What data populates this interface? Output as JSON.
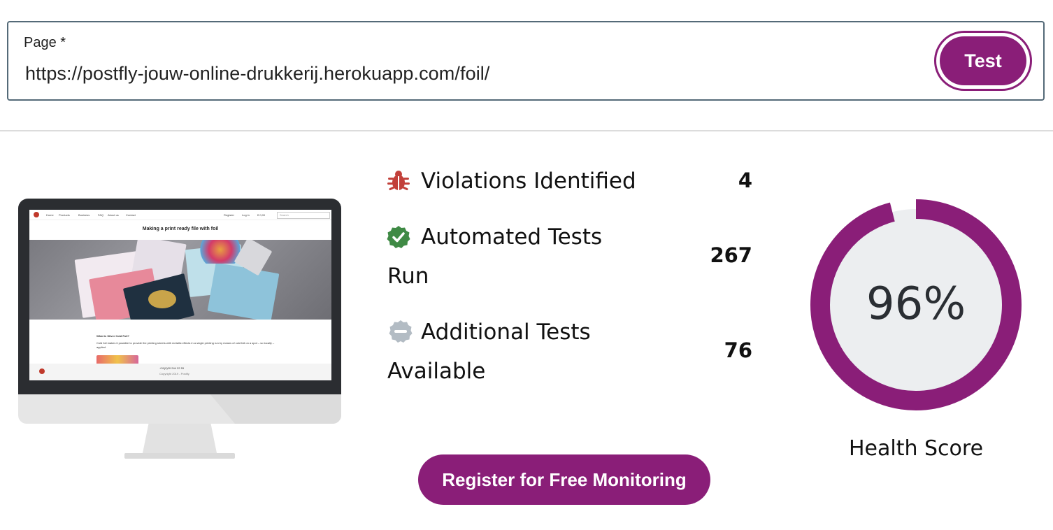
{
  "form": {
    "label": "Page *",
    "url": "https://postfly-jouw-online-drukkerij.herokuapp.com/foil/",
    "test_button": "Test"
  },
  "preview": {
    "page_title": "Making a print ready file with foil",
    "nav_items": [
      "Home",
      "Products",
      "Business",
      "FAQ",
      "About us",
      "Contact"
    ],
    "right_nav": [
      "Register",
      "Log in",
      "€ 0,00"
    ],
    "search_placeholder": "Search",
    "section_heading": "What is Silver Cold Foil?",
    "section_text": "Cold foil makes it possible to provide the printing sheets with metallic effects in a single printing run by means of cold foil on a spot – so locally – applied.",
    "footer_phone": "+31(0)20 244 22 53",
    "footer_copy": "Copyright 2019 - Postfly"
  },
  "stats": [
    {
      "icon": "bug-icon",
      "label": "Violations Identified",
      "value": "4"
    },
    {
      "icon": "check-badge-icon",
      "label": "Automated Tests Run",
      "value": "267"
    },
    {
      "icon": "minus-badge-icon",
      "label": "Additional Tests Available",
      "value": "76"
    }
  ],
  "register_button": "Register for Free Monitoring",
  "health": {
    "value_text": "96%",
    "fraction": 0.96,
    "label": "Health Score"
  },
  "colors": {
    "brand": "#8a1e78",
    "bug": "#c2403a",
    "check": "#3f8a45",
    "neutral": "#b3bcc4",
    "track": "#eceef0"
  }
}
